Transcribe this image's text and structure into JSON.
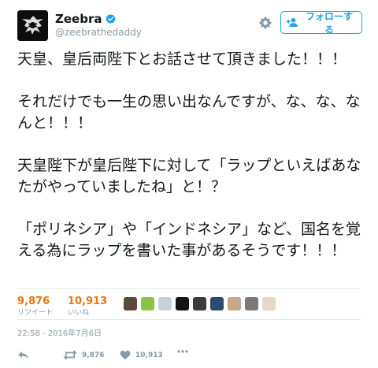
{
  "user": {
    "display_name": "Zeebra",
    "handle": "@zeebrathedaddy",
    "verified_icon": "verified-badge-icon"
  },
  "follow_button": {
    "label": "フォローする",
    "icon": "add-user-icon"
  },
  "tweet": {
    "paragraphs": [
      "天皇、皇后両陛下とお話させて頂きました！！！",
      "それだけでも一生の思い出なんですが、な、な、なんと！！！",
      "天皇陛下が皇后陛下に対して「ラップといえばあなたがやっていましたね」と！？",
      "「ポリネシア」や「インドネシア」など、国名を覚える為にラップを書いた事があるそうです！！！"
    ]
  },
  "stats": {
    "retweets": {
      "count": "9,876",
      "label": "リツイート"
    },
    "likes": {
      "count": "10,913",
      "label": "いいね"
    }
  },
  "liker_avatars": [
    "#5a4b3a",
    "#8bc34a",
    "#c7d0d6",
    "#141414",
    "#3c3c3c",
    "#2c4a6e",
    "#c9a88a",
    "#7a7a7a",
    "#e6d8c8"
  ],
  "timestamp": "22:58 - 2016年7月6日",
  "actions": {
    "retweet_count": "9,876",
    "like_count": "10,913"
  },
  "colors": {
    "accent": "#1da1f2",
    "stat_number": "#e8760c",
    "muted": "#8899a6"
  }
}
